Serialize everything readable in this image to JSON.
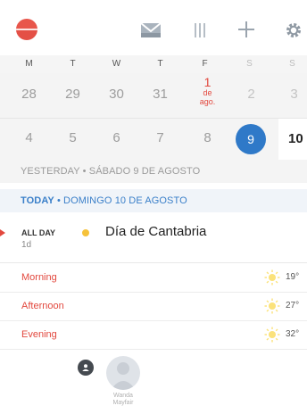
{
  "toolbar": {
    "icons": [
      "sync-indicator-icon",
      "inbox-icon",
      "list-view-icon",
      "add-icon",
      "settings-icon"
    ],
    "accent_color": "#e8564b"
  },
  "weekdays": [
    "M",
    "T",
    "W",
    "T",
    "F",
    "S",
    "S"
  ],
  "weeks": [
    [
      {
        "num": "28"
      },
      {
        "num": "29"
      },
      {
        "num": "30"
      },
      {
        "num": "31"
      },
      {
        "num": "1",
        "sub1": "de",
        "sub2": "ago."
      },
      {
        "num": "2"
      },
      {
        "num": "3"
      }
    ],
    [
      {
        "num": "4"
      },
      {
        "num": "5"
      },
      {
        "num": "6"
      },
      {
        "num": "7"
      },
      {
        "num": "8"
      },
      {
        "num": "9"
      },
      {
        "num": "10"
      }
    ]
  ],
  "agenda": {
    "yesterday": "YESTERDAY • SÁBADO 9 DE AGOSTO",
    "today_prefix": "TODAY",
    "today_rest": " • DOMINGO 10 DE AGOSTO",
    "allday_label": "ALL DAY",
    "allday_duration": "1d",
    "event_title": "Día de Cantabria",
    "event_color": "#f6c23a"
  },
  "weather": [
    {
      "label": "Morning",
      "temp": "19°",
      "icon": "sun-icon"
    },
    {
      "label": "Afternoon",
      "temp": "27°",
      "icon": "sun-icon"
    },
    {
      "label": "Evening",
      "temp": "32°",
      "icon": "sun-icon"
    }
  ],
  "people": {
    "name_line1": "Wanda",
    "name_line2": "Mayfair",
    "selected_color": "#2f79c8"
  }
}
